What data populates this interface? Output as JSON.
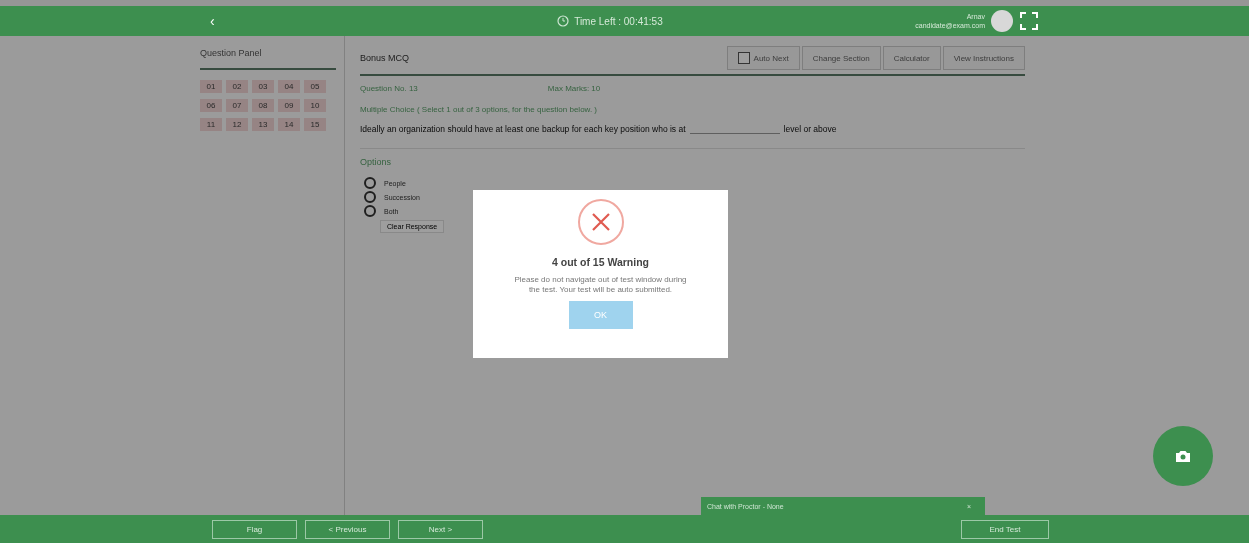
{
  "header": {
    "back": "‹",
    "timer": "Time Left : 00:41:53",
    "user_name": "Arnav",
    "user_email": "candidate@exam.com"
  },
  "question_panel": {
    "title": "Question Panel",
    "numbers": [
      "01",
      "02",
      "03",
      "04",
      "05",
      "06",
      "07",
      "08",
      "09",
      "10",
      "11",
      "12",
      "13",
      "14",
      "15"
    ]
  },
  "section": {
    "title": "Bonus MCQ",
    "auto_next": {
      "label": "Auto Next",
      "checked": false
    },
    "buttons": [
      "Change Section",
      "Calculator",
      "View Instructions"
    ]
  },
  "question": {
    "number": "Question No. 13",
    "marks": "Max Marks: 10",
    "instruction": "Multiple Choice ( Select 1 out of 3 options, for the question below. )",
    "text_before": "Ideally an organization should have at least one backup for each key position who is at",
    "text_after": "level or above"
  },
  "options": {
    "title": "Options",
    "items": [
      {
        "label": "People",
        "selected": false
      },
      {
        "label": "Succession",
        "selected": false
      },
      {
        "label": "Both",
        "selected": false
      }
    ],
    "clear": "Clear Response"
  },
  "modal": {
    "title": "4 out of 15 Warning",
    "message": "Please do not navigate out of test window during the test. Your test will be auto submitted.",
    "button": "OK"
  },
  "chat": {
    "title": "Chat with Proctor - None",
    "close": "×"
  },
  "footer": {
    "left_buttons": [
      "Flag",
      "< Previous",
      "Next >"
    ],
    "end": "End Test"
  }
}
